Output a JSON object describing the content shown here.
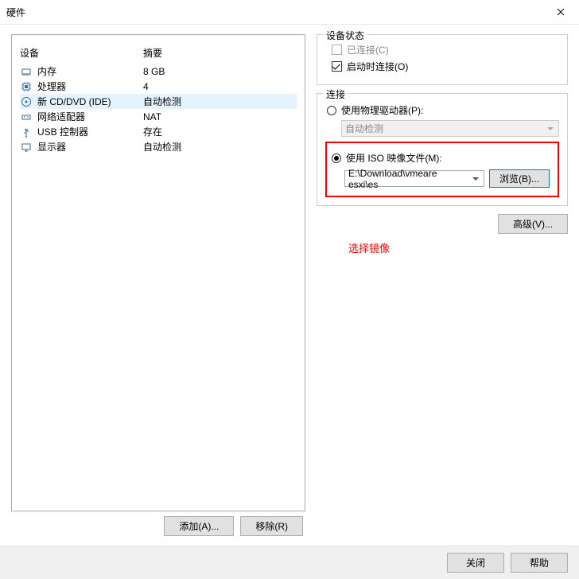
{
  "title": "硬件",
  "device_header": {
    "device": "设备",
    "summary": "摘要"
  },
  "devices": [
    {
      "icon": "memory-icon",
      "name": "内存",
      "summary": "8 GB",
      "selected": false
    },
    {
      "icon": "cpu-icon",
      "name": "处理器",
      "summary": "4",
      "selected": false
    },
    {
      "icon": "cd-icon",
      "name": "新 CD/DVD (IDE)",
      "summary": "自动检测",
      "selected": true
    },
    {
      "icon": "network-icon",
      "name": "网络适配器",
      "summary": "NAT",
      "selected": false
    },
    {
      "icon": "usb-icon",
      "name": "USB 控制器",
      "summary": "存在",
      "selected": false
    },
    {
      "icon": "display-icon",
      "name": "显示器",
      "summary": "自动检测",
      "selected": false
    }
  ],
  "left_buttons": {
    "add": "添加(A)...",
    "remove": "移除(R)"
  },
  "status": {
    "title": "设备状态",
    "connected": {
      "label": "已连接(C)",
      "checked": false,
      "disabled": true
    },
    "connect_on": {
      "label": "启动时连接(O)",
      "checked": true,
      "disabled": false
    }
  },
  "connection": {
    "title": "连接",
    "physical": {
      "label": "使用物理驱动器(P):",
      "checked": false,
      "dropdown": "自动检测"
    },
    "iso": {
      "label": "使用 ISO 映像文件(M):",
      "checked": true,
      "path": "E:\\Download\\vmeare esxi\\es"
    },
    "browse": "浏览(B)..."
  },
  "advanced": "高级(V)...",
  "annotation": "选择镜像",
  "footer": {
    "close": "关闭",
    "help": "帮助"
  }
}
